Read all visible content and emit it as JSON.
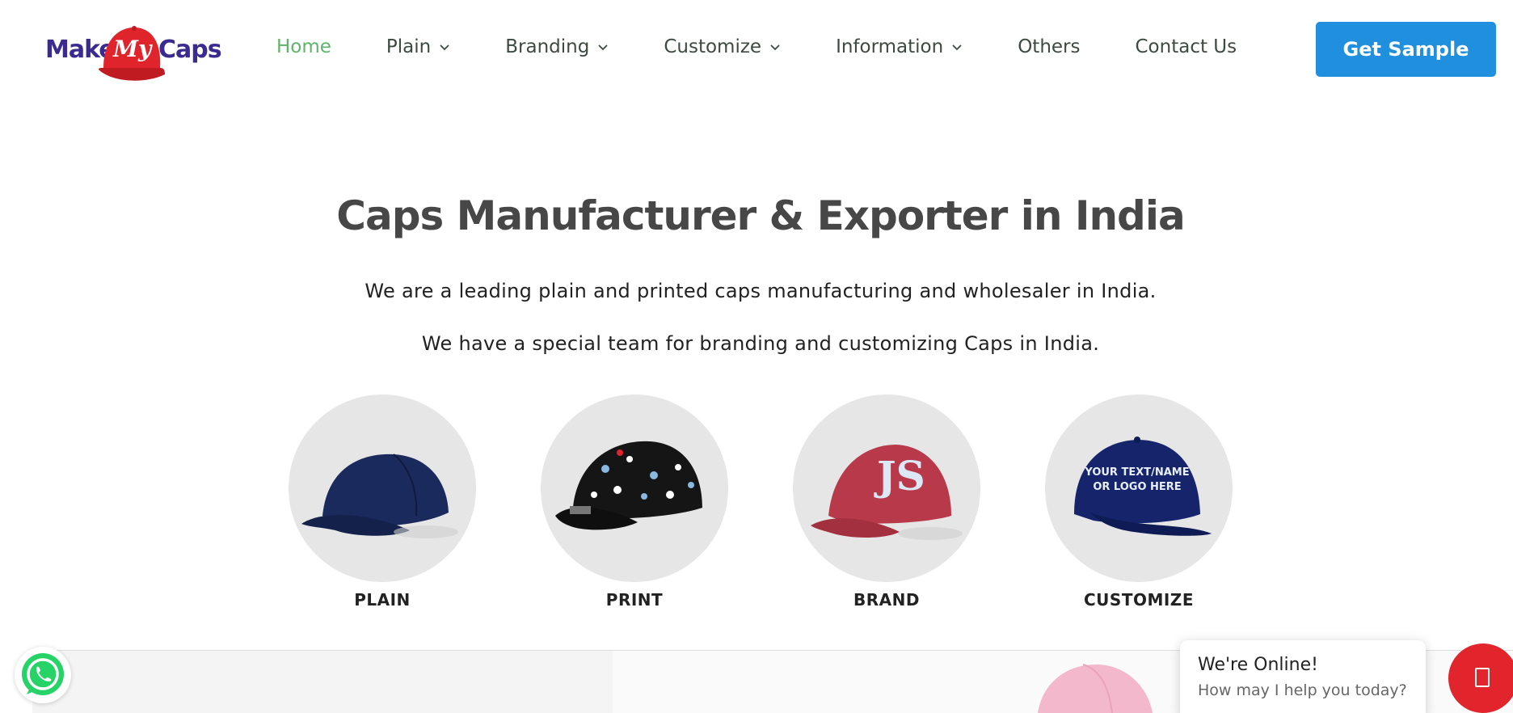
{
  "brand": {
    "make": "Make",
    "my": "My",
    "caps": "Caps"
  },
  "nav": {
    "items": [
      {
        "label": "Home",
        "active": true,
        "dropdown": false
      },
      {
        "label": "Plain",
        "dropdown": true
      },
      {
        "label": "Branding",
        "dropdown": true
      },
      {
        "label": "Customize",
        "dropdown": true
      },
      {
        "label": "Information",
        "dropdown": true
      },
      {
        "label": "Others",
        "dropdown": false
      },
      {
        "label": "Contact Us",
        "dropdown": false
      }
    ],
    "cta": "Get Sample"
  },
  "hero": {
    "title": "Caps Manufacturer & Exporter in India",
    "line1": "We are a leading plain and printed caps manufacturing and wholesaler in India.",
    "line2": "We have a special team for branding and customizing Caps in India."
  },
  "categories": [
    {
      "label": "PLAIN"
    },
    {
      "label": "PRINT"
    },
    {
      "label": "BRAND"
    },
    {
      "label": "CUSTOMIZE",
      "cap_text": "YOUR TEXT/NAME\nOR LOGO HERE"
    }
  ],
  "chat": {
    "title": "We're Online!",
    "subtitle": "How may I help you today?"
  },
  "colors": {
    "accent": "#1f8fde",
    "nav_active": "#5cb56b",
    "chat_red": "#e2242d",
    "whatsapp": "#25d366"
  }
}
